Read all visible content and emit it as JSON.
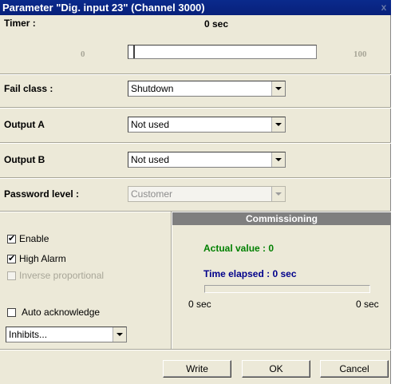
{
  "window": {
    "title": "Parameter \"Dig. input 23\" (Channel 3000)",
    "close_glyph": "x"
  },
  "timer": {
    "label": "Timer :",
    "value_text": "0 sec",
    "min": "0",
    "max": "100",
    "value": 0
  },
  "fail_class": {
    "label": "Fail class :",
    "selected": "Shutdown"
  },
  "output_a": {
    "label": "Output A",
    "selected": "Not used"
  },
  "output_b": {
    "label": "Output B",
    "selected": "Not used"
  },
  "password_level": {
    "label": "Password level :",
    "selected": "Customer"
  },
  "options": {
    "enable": {
      "label": "Enable",
      "checked": true
    },
    "high_alarm": {
      "label": "High Alarm",
      "checked": true
    },
    "inverse_proportional": {
      "label": "Inverse proportional",
      "checked": false,
      "disabled": true
    },
    "auto_acknowledge": {
      "label": "Auto acknowledge",
      "checked": false
    },
    "inhibits": {
      "selected": "Inhibits..."
    }
  },
  "commissioning": {
    "header": "Commissioning",
    "actual_value": "Actual value : 0",
    "time_elapsed": "Time elapsed : 0 sec",
    "progress_min": "0 sec",
    "progress_max": "0 sec",
    "progress": 0,
    "colors": {
      "header_bg": "#7f7f7f",
      "actual": "#008000",
      "elapsed": "#00008b"
    }
  },
  "footer": {
    "write_label": "Write",
    "ok_label": "OK",
    "cancel_label": "Cancel"
  }
}
